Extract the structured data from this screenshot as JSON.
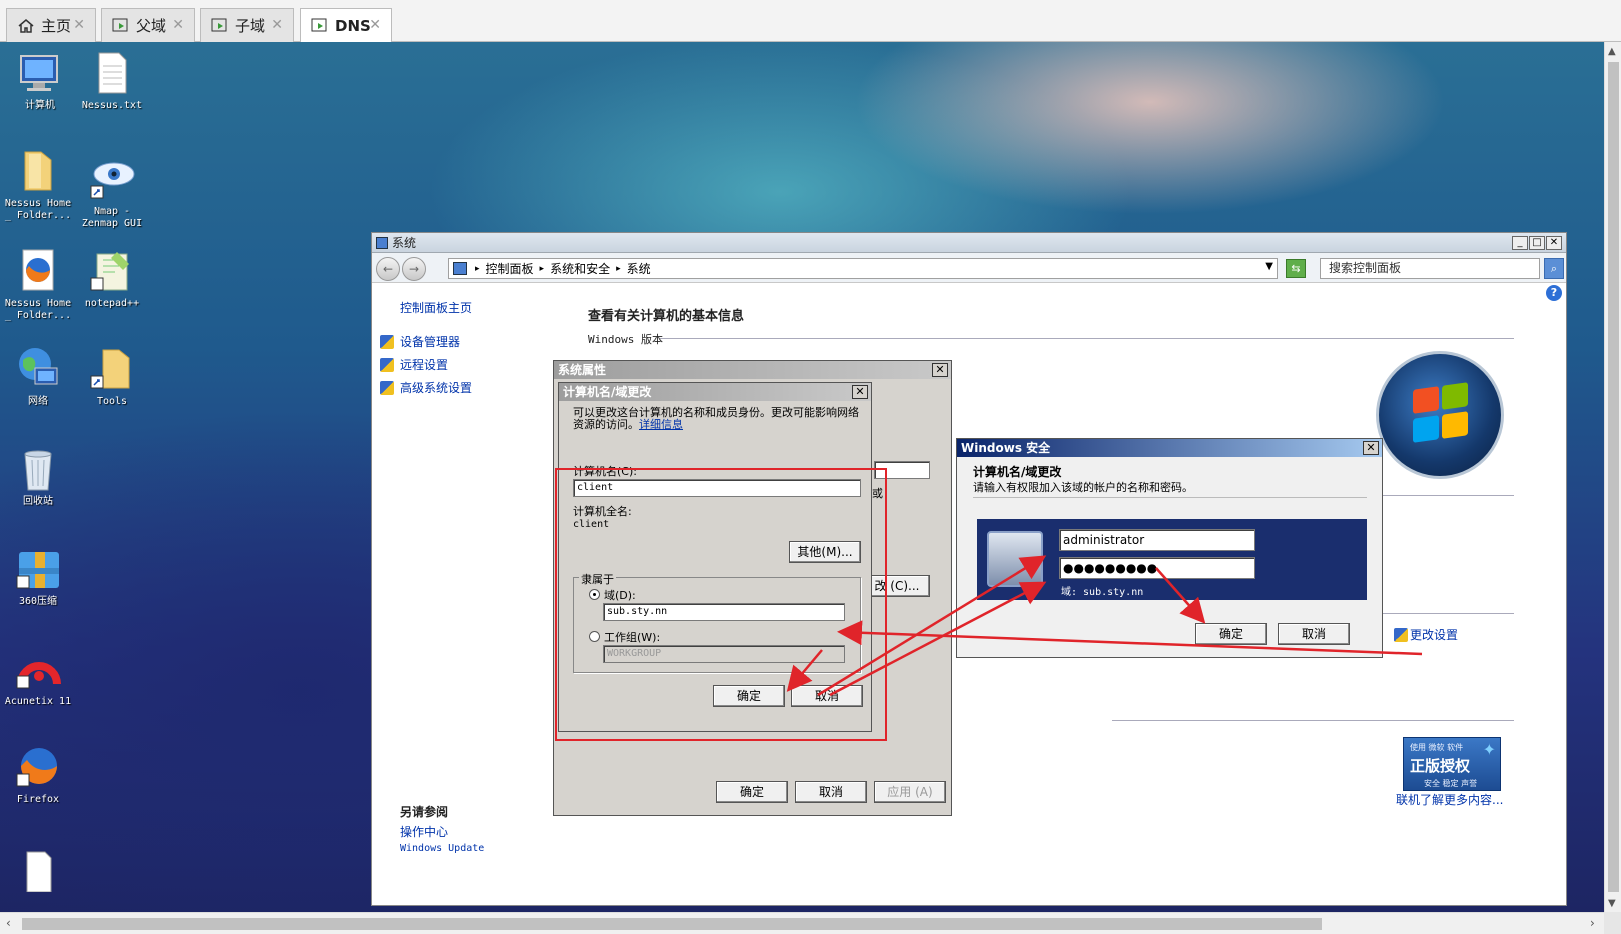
{
  "tabs": [
    {
      "label": "主页",
      "icon": "home-icon"
    },
    {
      "label": "父域",
      "icon": "vm-icon"
    },
    {
      "label": "子域",
      "icon": "vm-icon"
    },
    {
      "label": "DNS",
      "icon": "vm-icon"
    }
  ],
  "desktop_icons": [
    {
      "label": "计算机",
      "icon": "computer-icon"
    },
    {
      "label": "Nessus.txt",
      "icon": "text-file-icon"
    },
    {
      "label": "Nessus Home _ Folder...",
      "icon": "folder-icon"
    },
    {
      "label": "Nmap - Zenmap GUI",
      "icon": "eye-shortcut-icon"
    },
    {
      "label": "Nessus Home _ Folder...",
      "icon": "firefox-icon"
    },
    {
      "label": "notepad++",
      "icon": "notepad-plus-icon"
    },
    {
      "label": "网络",
      "icon": "network-icon"
    },
    {
      "label": "Tools",
      "icon": "folder-shortcut-icon"
    },
    {
      "label": "回收站",
      "icon": "recycle-bin-icon"
    },
    {
      "label": "360压缩",
      "icon": "archive-icon"
    },
    {
      "label": "Acunetix 11",
      "icon": "acunetix-icon"
    },
    {
      "label": "Firefox",
      "icon": "firefox-icon"
    }
  ],
  "system_window": {
    "title": "系统",
    "breadcrumbs": [
      "控制面板",
      "系统和安全",
      "系统"
    ],
    "search_placeholder": "搜索控制面板",
    "left_nav": {
      "home": "控制面板主页",
      "links": [
        "设备管理器",
        "远程设置",
        "高级系统设置"
      ]
    },
    "heading": "查看有关计算机的基本信息",
    "version_label": "Windows 版本",
    "see_also_title": "另请参阅",
    "see_also_links": [
      "操作中心",
      "Windows Update"
    ],
    "change_settings": "更改设置",
    "license": {
      "top": "使用 微软 软件",
      "main": "正版授权",
      "sub": "安全 稳定 声誉",
      "link": "联机了解更多内容..."
    }
  },
  "sysprops_dialog": {
    "title": "系统属性",
    "partial_button": "改 (C)...",
    "partial_text": "或",
    "ok": "确定",
    "cancel": "取消",
    "apply": "应用 (A)"
  },
  "rename_dialog": {
    "title": "计算机名/域更改",
    "description": "可以更改这台计算机的名称和成员身份。更改可能影响网络资源的访问。",
    "details_link": "详细信息",
    "computer_name_label": "计算机名(C):",
    "computer_name_value": "client",
    "full_name_label": "计算机全名:",
    "full_name_value": "client",
    "other_button": "其他(M)...",
    "member_of": "隶属于",
    "domain_label": "域(D):",
    "domain_value": "sub.sty.nn",
    "workgroup_label": "工作组(W):",
    "workgroup_value": "WORKGROUP",
    "ok": "确定",
    "cancel": "取消"
  },
  "security_dialog": {
    "title": "Windows 安全",
    "heading": "计算机名/域更改",
    "prompt": "请输入有权限加入该域的帐户的名称和密码。",
    "username": "administrator",
    "password": "●●●●●●●●●",
    "domain_hint": "域: sub.sty.nn",
    "ok": "确定",
    "cancel": "取消"
  },
  "colors": {
    "annotation_red": "#e0242a",
    "link_blue": "#0033aa",
    "security_banner": "#1a2e6e"
  }
}
